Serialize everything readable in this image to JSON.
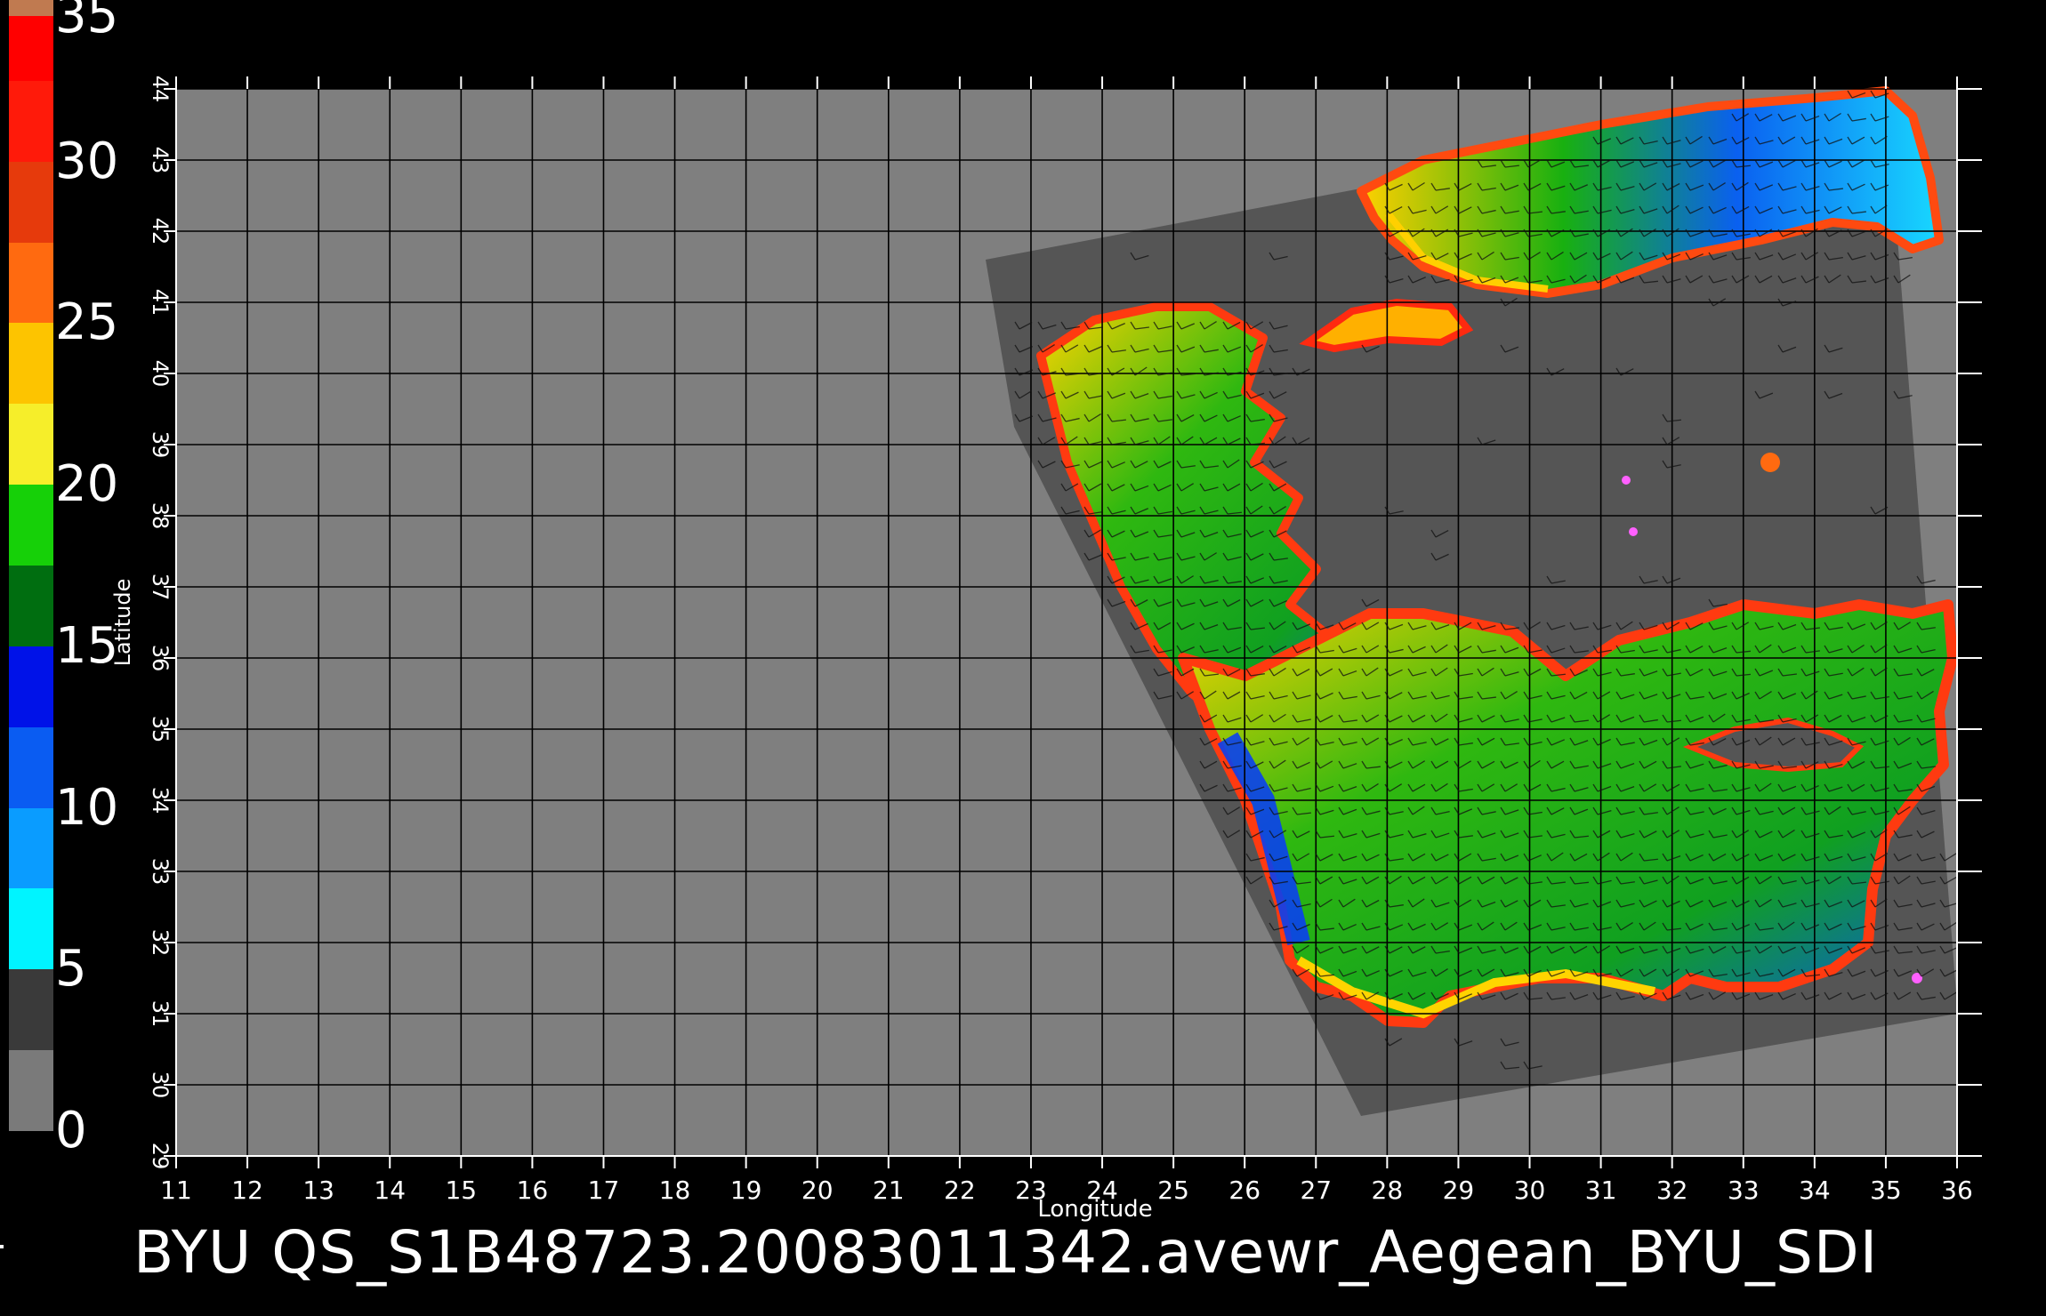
{
  "caption": "BYU  QS_S1B48723.20083011342.avewr_Aegean_BYU_SDI",
  "colorbar": {
    "labels": [
      "35",
      "30",
      "25",
      "20",
      "15",
      "10",
      "5",
      "0"
    ],
    "segments": [
      {
        "from": 0,
        "to": 2.5,
        "color": "#7a7a7a"
      },
      {
        "from": 2.5,
        "to": 5,
        "color": "#3a3a3a"
      },
      {
        "from": 5,
        "to": 7.5,
        "color": "#00f4ff"
      },
      {
        "from": 7.5,
        "to": 10,
        "color": "#0a9cff"
      },
      {
        "from": 10,
        "to": 12.5,
        "color": "#0a5cf2"
      },
      {
        "from": 12.5,
        "to": 15,
        "color": "#0012e8"
      },
      {
        "from": 15,
        "to": 17.5,
        "color": "#006e10"
      },
      {
        "from": 17.5,
        "to": 20,
        "color": "#16d008"
      },
      {
        "from": 20,
        "to": 22.5,
        "color": "#f6ee2a"
      },
      {
        "from": 22.5,
        "to": 25,
        "color": "#fdc400"
      },
      {
        "from": 25,
        "to": 27.5,
        "color": "#ff6a10"
      },
      {
        "from": 27.5,
        "to": 30,
        "color": "#e63a0c"
      },
      {
        "from": 30,
        "to": 32.5,
        "color": "#ff1a0a"
      },
      {
        "from": 32.5,
        "to": 34.5,
        "color": "#ff0000"
      },
      {
        "from": 34.5,
        "to": 35,
        "color": "#c07a50"
      }
    ]
  },
  "map": {
    "xlabel": "Longitude",
    "ylabel": "Latitude",
    "lon_range": [
      11,
      36
    ],
    "lat_range": [
      29,
      44
    ],
    "lon_ticks": [
      "11",
      "12",
      "13",
      "14",
      "15",
      "16",
      "17",
      "18",
      "19",
      "20",
      "21",
      "22",
      "23",
      "24",
      "25",
      "26",
      "27",
      "28",
      "29",
      "30",
      "31",
      "32",
      "33",
      "34",
      "35",
      "36"
    ],
    "lat_ticks": [
      "29",
      "30",
      "31",
      "32",
      "33",
      "34",
      "35",
      "36",
      "37",
      "38",
      "39",
      "40",
      "41",
      "42",
      "43",
      "44"
    ],
    "background_color": "#7f7f7f",
    "swath_color": "#555555",
    "grid_color": "#000000"
  }
}
